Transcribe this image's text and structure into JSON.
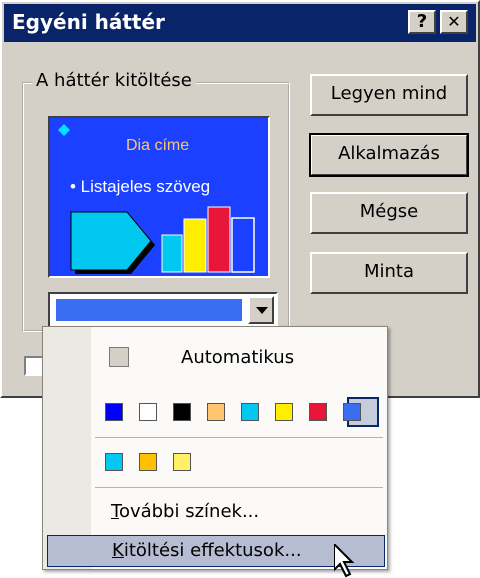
{
  "dialog": {
    "title": "Egyéni háttér",
    "help_button": "?",
    "close_button": "✕",
    "group_label": "A háttér kitöltése",
    "buttons": {
      "apply_all": "Legyen mind",
      "apply": "Alkalmazás",
      "cancel": "Mégse",
      "preview": "Minta"
    },
    "preview": {
      "slide_title": "Dia címe",
      "bullet_text": "• Listajeles szöveg",
      "background_color": "#1c40ff"
    },
    "fill_combo": {
      "selected_color": "#3a6ef2"
    }
  },
  "menu": {
    "automatic_label": "Automatikus",
    "palette_row1": [
      "#0000ff",
      "#ffffff",
      "#000000",
      "#ffc66e",
      "#00c8f0",
      "#ffee00",
      "#e8173a",
      "#3a6ef2"
    ],
    "palette_row2": [
      "#00c8f0",
      "#ffc000",
      "#fff066"
    ],
    "selected_swatch_index": 7,
    "more_colors": {
      "hotkey": "T",
      "rest": "ovábbi színek..."
    },
    "fill_effects": {
      "hotkey": "K",
      "rest": "itöltési effektusok..."
    }
  }
}
